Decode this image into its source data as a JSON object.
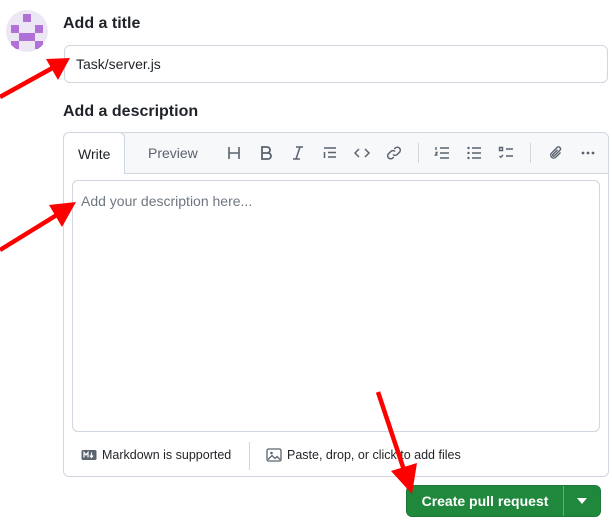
{
  "title_section": {
    "label": "Add a title",
    "input_value": "Task/server.js"
  },
  "description_section": {
    "label": "Add a description",
    "tabs": [
      {
        "label": "Write",
        "active": true
      },
      {
        "label": "Preview",
        "active": false
      }
    ],
    "toolbar_icons": [
      "heading-icon",
      "bold-icon",
      "italic-icon",
      "quote-icon",
      "code-icon",
      "link-icon",
      "ordered-list-icon",
      "unordered-list-icon",
      "task-list-icon",
      "attach-icon",
      "more-icon"
    ],
    "placeholder": "Add your description here...",
    "footer": {
      "markdown_label": "Markdown is supported",
      "files_label": "Paste, drop, or click to add files"
    }
  },
  "actions": {
    "create_label": "Create pull request"
  },
  "colors": {
    "primary_button": "#1f883d",
    "annotation_arrow": "#ff0000",
    "border": "#d0d7de",
    "avatar_accent": "#b071d6"
  }
}
